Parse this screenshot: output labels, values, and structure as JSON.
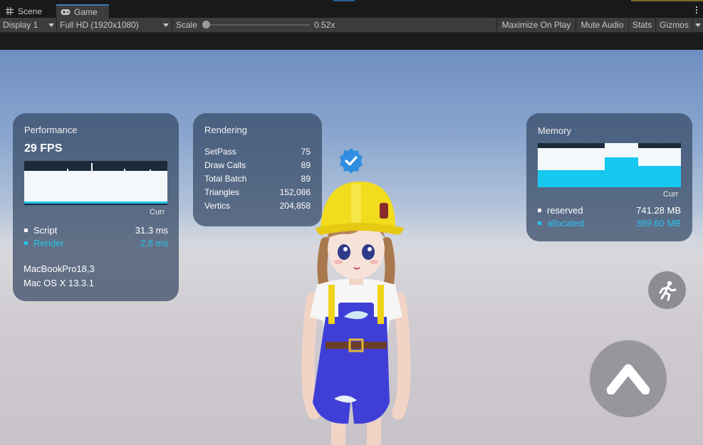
{
  "tabs": {
    "scene_label": "Scene",
    "game_label": "Game"
  },
  "toolbar": {
    "display_label": "Display 1",
    "resolution_label": "Full HD (1920x1080)",
    "scale_label": "Scale",
    "scale_value": "0.52x",
    "scale_fraction": 0.0,
    "maximize_label": "Maximize On Play",
    "mute_label": "Mute Audio",
    "stats_label": "Stats",
    "gizmos_label": "Gizmos"
  },
  "performance": {
    "title": "Performance",
    "fps": "29 FPS",
    "curr_label": "Curr",
    "script_label": "Script",
    "script_value": "31.3 ms",
    "render_label": "Render",
    "render_value": "2.8 ms",
    "device": "MacBookPro18,3",
    "os": "Mac OS X 13.3.1"
  },
  "rendering": {
    "title": "Rendering",
    "rows": [
      {
        "label": "SetPass",
        "value": "75"
      },
      {
        "label": "Draw Calls",
        "value": "89"
      },
      {
        "label": "Total Batch",
        "value": "89"
      },
      {
        "label": "Triangles",
        "value": "152,086"
      },
      {
        "label": "Vertics",
        "value": "204,858"
      }
    ]
  },
  "memory": {
    "title": "Memory",
    "curr_label": "Curr",
    "reserved_label": "reserved",
    "reserved_value": "741.28 MB",
    "allocated_label": "allocated",
    "allocated_value": "389.60 MB"
  },
  "colors": {
    "accent_cyan": "#29c3ec",
    "panel_bg": "#344864",
    "helmet_yellow": "#f2dc1e",
    "overalls_blue": "#3f3fd8"
  },
  "icons": {
    "scene": "hash-icon",
    "game": "gamepad-icon",
    "run": "running-person-icon",
    "jump": "chevron-up-icon",
    "verified": "verified-badge-icon"
  }
}
